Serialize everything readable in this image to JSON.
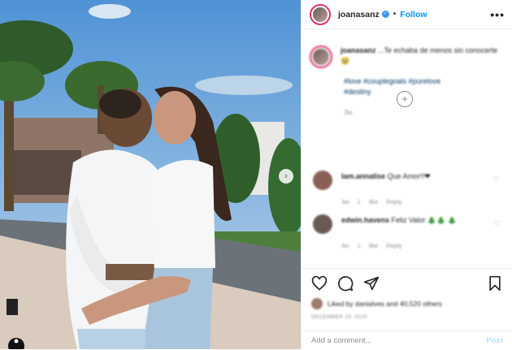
{
  "header": {
    "username": "joanasanz",
    "separator": "•",
    "follow_label": "Follow",
    "more_label": "•••",
    "verified_mark": "✓"
  },
  "caption": {
    "username": "joanasanz",
    "text": "...Te echaba de menos sin conocerte 🥹",
    "hashtags": "#love #couplegoals #purelove #destiny",
    "time": "3w"
  },
  "load_more_label": "+",
  "comments": [
    {
      "username": "lam.annalise",
      "text": "Que Amor!!❤",
      "time": "3w",
      "likes": "1 like",
      "reply": "Reply"
    },
    {
      "username": "edwin.havens",
      "text": "Feliz Valor 🎄🎄 🎄",
      "time": "3w",
      "likes": "1 like",
      "reply": "Reply"
    }
  ],
  "likes_text": "Liked by danialves and 40,520 others",
  "date": "DECEMBER 15, 2020",
  "add_comment_placeholder": "Add a comment...",
  "post_label": "Post",
  "next_arrow": "›",
  "colors": {
    "accent": "#0095f6",
    "ring": "#e1306c",
    "muted": "#8e8e8e"
  },
  "icons": [
    "heart-icon",
    "comment-icon",
    "share-icon",
    "save-icon",
    "chevron-right-icon",
    "tag-person-icon",
    "more-icon",
    "emoji-icon"
  ]
}
